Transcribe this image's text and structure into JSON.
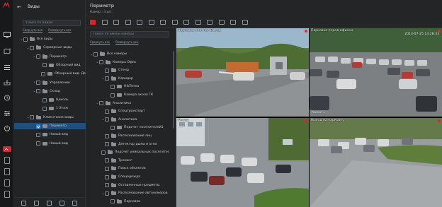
{
  "app": {
    "rail_icons": [
      "logo-icon",
      "monitor-icon",
      "map-icon",
      "list-icon",
      "archive-icon",
      "history-icon",
      "settings-icon",
      "power-icon",
      "chevron-up-icon",
      "document-icon",
      "document-icon",
      "document-icon",
      "document-icon"
    ],
    "accent_color": "#d6262b",
    "select_color": "#2f86d6"
  },
  "views_panel": {
    "title": "Виды",
    "search_placeholder": "Поиск по видам",
    "collapse_all": "Свернуть все",
    "expand_all": "Развернуть все",
    "items": [
      {
        "label": "Все виды",
        "type": "folder",
        "level": 0,
        "expanded": true
      },
      {
        "label": "Серверные виды",
        "type": "folder",
        "level": 1,
        "expanded": true
      },
      {
        "label": "Периметр",
        "type": "folder",
        "level": 2,
        "expanded": true
      },
      {
        "label": "Обзорный вид",
        "type": "view",
        "level": 3
      },
      {
        "label": "Обзорный вид. Де",
        "type": "view",
        "level": 3
      },
      {
        "label": "Управление",
        "type": "folder",
        "level": 2,
        "expanded": false
      },
      {
        "label": "Склад",
        "type": "folder",
        "level": 2,
        "expanded": true
      },
      {
        "label": "Цоколь",
        "type": "view",
        "level": 3
      },
      {
        "label": "1 Этаж",
        "type": "view",
        "level": 3
      },
      {
        "label": "Клиентские виды",
        "type": "folder",
        "level": 1,
        "expanded": true
      },
      {
        "label": "Периметр",
        "type": "view",
        "level": 2,
        "checked": true,
        "selected": true
      },
      {
        "label": "Новый вид",
        "type": "view",
        "level": 2
      },
      {
        "label": "Новый вид",
        "type": "view",
        "level": 2
      }
    ],
    "footer_icons": [
      "add-view-icon",
      "add-folder-icon",
      "copy-icon",
      "edit-icon",
      "delete-icon"
    ]
  },
  "view": {
    "title": "Периметр",
    "camera_count": "Камер : 4 шт.",
    "layout_icons": 14
  },
  "camera_panel": {
    "search_placeholder": "Поиск по имени камеры",
    "collapse_all": "Свернуть все",
    "expand_all": "Развернуть все",
    "items": [
      {
        "label": "Все камеры",
        "type": "folder",
        "level": 0,
        "expanded": true
      },
      {
        "label": "Камеры Офис",
        "type": "folder",
        "level": 1,
        "expanded": true
      },
      {
        "label": "Стенд",
        "type": "folder",
        "level": 2
      },
      {
        "label": "Коридор",
        "type": "folder",
        "level": 2,
        "expanded": true
      },
      {
        "label": "HikTerma",
        "type": "camera",
        "level": 3
      },
      {
        "label": "Камера около ГК",
        "type": "camera",
        "level": 3
      },
      {
        "label": "Аналитика",
        "type": "folder",
        "level": 1,
        "expanded": true
      },
      {
        "label": "Спецтранспорт",
        "type": "folder",
        "level": 2
      },
      {
        "label": "Аналитика",
        "type": "folder",
        "level": 2,
        "expanded": true
      },
      {
        "label": "Подсчет посетителей1",
        "type": "camera",
        "level": 3
      },
      {
        "label": "Распознавание лиц",
        "type": "folder",
        "level": 2
      },
      {
        "label": "Детектор дыма и огня",
        "type": "folder",
        "level": 2
      },
      {
        "label": "Подсчет уникальных посетителе",
        "type": "folder",
        "level": 2
      },
      {
        "label": "Трекинг",
        "type": "folder",
        "level": 2
      },
      {
        "label": "Поиск объектов",
        "type": "folder",
        "level": 2
      },
      {
        "label": "Спецодежда",
        "type": "folder",
        "level": 2
      },
      {
        "label": "Оставленные предметы",
        "type": "folder",
        "level": 2
      },
      {
        "label": "Распознавание автономеров",
        "type": "folder",
        "level": 2,
        "expanded": true
      },
      {
        "label": "Парковки",
        "type": "folder",
        "level": 3
      }
    ]
  },
  "video_tiles": [
    {
      "label": "Парковка платная Въезд",
      "timestamp": "",
      "channel": ""
    },
    {
      "label": "Парковка перед офисом",
      "timestamp": "2013-07-25 13:28:33",
      "channel": "Канал 1"
    },
    {
      "label": "Фасад",
      "timestamp": "",
      "channel": ""
    },
    {
      "label": "Выход на парковку",
      "timestamp": "",
      "channel": ""
    }
  ]
}
